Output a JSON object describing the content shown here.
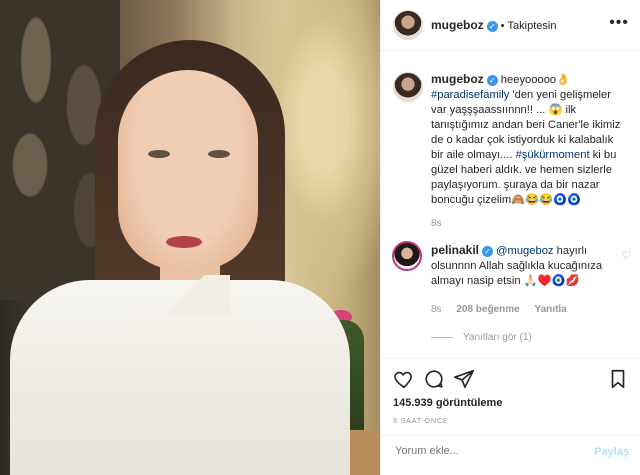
{
  "post": {
    "author": "mugeboz",
    "follow_status": "Takiptesin",
    "more_icon": "ellipsis-icon"
  },
  "caption": {
    "user": "mugeboz",
    "text_1": "heeyooooo👌",
    "hashtag_1": "#paradisefamily",
    "text_2": " 'den yeni gelişmeler var yaşşşaassıınnn!! ... 😱 ilk tanıştığımız andan beri Caner'le ikimiz de o kadar çok istiyorduk ki kalabalık bir aile olmayı.... ",
    "hashtag_2": "#şükürmoment",
    "text_3": " ki bu güzel haberi aldık. ve hemen sizlerle paylaşıyorum. şuraya da bir nazar boncuğu çizelim🙈😂😂🧿🧿",
    "time": "8s"
  },
  "reply_comment": {
    "user": "pelinakil",
    "mention": "@mugeboz",
    "text": " hayırlı olsunnnn Allah sağlıkla kucağınıza almayı nasip etsin 🙏🏻♥️🧿💋",
    "time": "8s",
    "likes": "208 beğenme",
    "reply_label": "Yanıtla",
    "view_replies": "Yanıtları gör (1)"
  },
  "stats": {
    "views_count": "145.939",
    "views_label": "görüntüleme",
    "posted_ago": "8 SAAT ÖNCE"
  },
  "add_comment": {
    "placeholder": "Yorum ekle...",
    "submit_label": "Paylaş"
  },
  "colors": {
    "verified": "#3897f0",
    "hashtag": "#003569",
    "muted": "#999999",
    "share_disabled": "#b2dffc"
  }
}
